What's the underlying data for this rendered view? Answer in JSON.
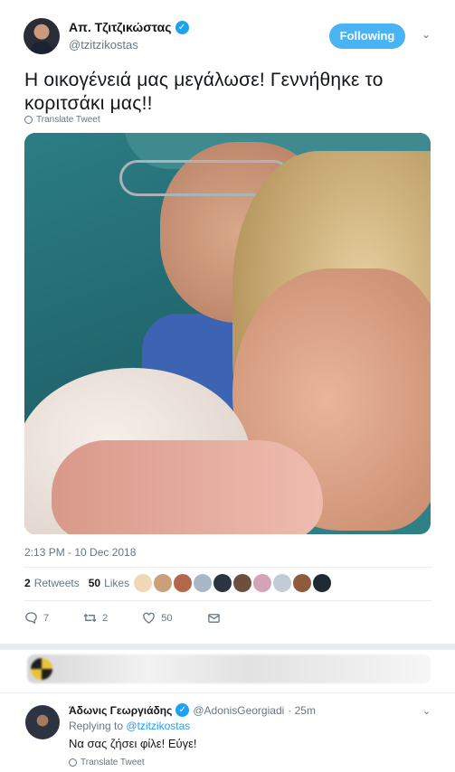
{
  "tweet": {
    "display_name": "Απ. Τζιτζικώστας",
    "handle": "@tzitzikostas",
    "follow_label": "Following",
    "text": "Η οικογένειά μας μεγάλωσε! Γεννήθηκε το κοριτσάκι μας!!",
    "translate_label": "Translate Tweet",
    "timestamp": "2:13 PM - 10 Dec 2018",
    "retweets_count": "2",
    "retweets_label": "Retweets",
    "likes_count": "50",
    "likes_label": "Likes",
    "actions": {
      "reply_count": "7",
      "retweet_count": "2",
      "like_count": "50"
    }
  },
  "reply": {
    "display_name": "Άδωνις Γεωργιάδης",
    "handle": "@AdonisGeorgiadi",
    "time": "· 25m",
    "replying_to_prefix": "Replying to",
    "replying_to_handle": "@tzitzikostas",
    "text": "Να σας ζήσει φίλε! Εύγε!",
    "translate_label": "Translate Tweet"
  },
  "colors": {
    "accent": "#1da1f2",
    "follow_bg": "#4ab3f4",
    "muted": "#657786",
    "border": "#e6ecf0"
  }
}
